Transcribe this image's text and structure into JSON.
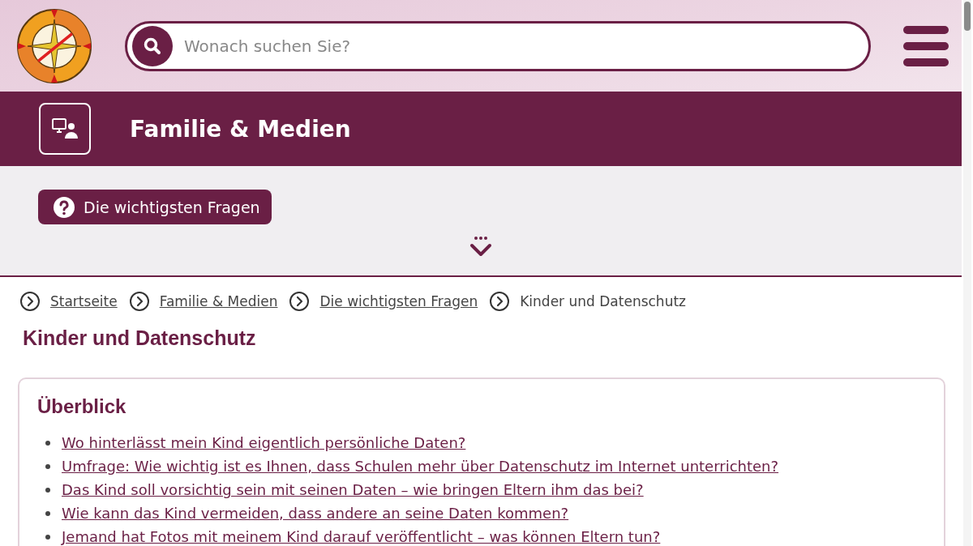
{
  "search": {
    "placeholder": "Wonach suchen Sie?"
  },
  "banner": {
    "title": "Familie & Medien"
  },
  "topics_button": {
    "label": "Die wichtigsten Fragen"
  },
  "breadcrumb": [
    {
      "label": "Startseite",
      "kind": "link"
    },
    {
      "label": "Familie & Medien",
      "kind": "link"
    },
    {
      "label": "Die wichtigsten Fragen",
      "kind": "link"
    },
    {
      "label": "Kinder und Datenschutz",
      "kind": "current"
    }
  ],
  "page_title": "Kinder und Datenschutz",
  "overview": {
    "title": "Überblick",
    "items": [
      "Wo hinterlässt mein Kind eigentlich persönliche Daten?",
      "Umfrage: Wie wichtig ist es Ihnen, dass Schulen mehr über Datenschutz im Internet unterrichten?",
      "Das Kind soll vorsichtig sein mit seinen Daten – wie bringen Eltern ihm das bei?",
      "Wie kann das Kind vermeiden, dass andere an seine Daten kommen?",
      "Jemand hat Fotos mit meinem Kind darauf veröffentlicht – was können Eltern tun?"
    ]
  }
}
